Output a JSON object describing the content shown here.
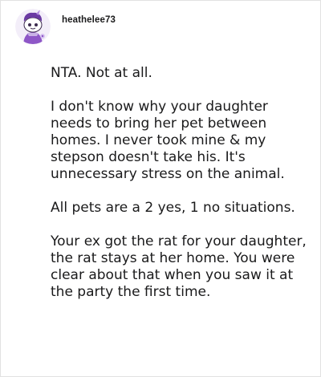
{
  "comment": {
    "username": "heathelee73",
    "paragraphs": [
      "NTA. Not at all.",
      "I don't know why your daughter needs to bring her pet between homes. I never took mine & my stepson doesn't take his. It's unnecessary stress on the animal.",
      "All pets are a 2 yes, 1 no situations.",
      "Your ex got the rat for your daughter, the rat stays at her home. You were clear about that when you saw it at the party the first time."
    ]
  },
  "colors": {
    "text": "#1a1a1b",
    "avatar_accent": "#8e57c7",
    "border": "#e2e2e2"
  },
  "icons": {
    "avatar": "reddit-snoo-avatar-icon"
  }
}
